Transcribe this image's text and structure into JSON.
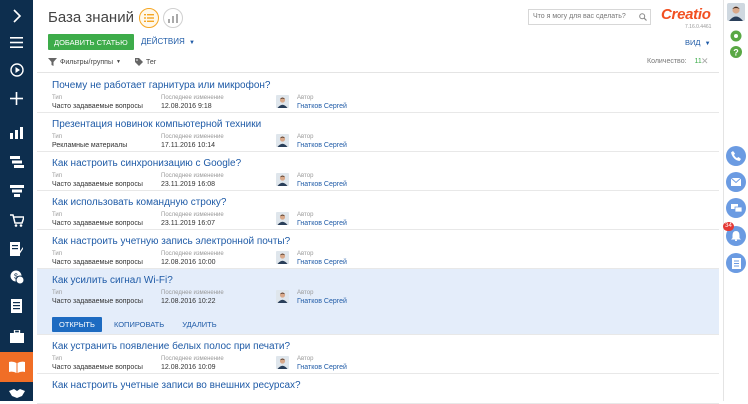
{
  "colors": {
    "nav_bg": "#0d2e4e",
    "nav_active": "#f06e26",
    "accent_green": "#3dac4a",
    "link_blue": "#1f5ba7",
    "selected_row": "#e4edfa",
    "comm_blue": "#6b9be2",
    "logo": "#f25022"
  },
  "leftnav": {
    "items": [
      {
        "icon": "chevron-right-icon"
      },
      {
        "icon": "menu-icon"
      },
      {
        "icon": "play-icon"
      },
      {
        "icon": "plus-icon"
      },
      {
        "icon": "chart-icon"
      },
      {
        "icon": "process-icon"
      },
      {
        "icon": "funnel-icon"
      },
      {
        "icon": "cart-icon"
      },
      {
        "icon": "document-edit-icon"
      },
      {
        "icon": "money-icon"
      },
      {
        "icon": "document-icon"
      },
      {
        "icon": "briefcase-icon"
      },
      {
        "icon": "book-icon",
        "active": true
      },
      {
        "icon": "handshake-icon"
      }
    ]
  },
  "header": {
    "title": "База знаний",
    "search_placeholder": "Что я могу для вас сделать?",
    "logo_text": "Creatio",
    "version": "7.16.0.4461"
  },
  "toolbar": {
    "add_label": "ДОБАВИТЬ СТАТЬЮ",
    "actions_label": "ДЕЙСТВИЯ",
    "view_label": "ВИД"
  },
  "filters": {
    "filters_label": "Фильтры/группы",
    "tag_label": "Тег",
    "count_label": "Количество:",
    "count_value": "11"
  },
  "columns": {
    "type": "Тип",
    "modified": "Последнее изменение",
    "author": "Автор"
  },
  "rows": [
    {
      "title": "Почему не работает гарнитура или микрофон?",
      "type": "Часто задаваемые вопросы",
      "modified": "12.08.2016 9:18",
      "author": "Гнатков Сергей"
    },
    {
      "title": "Презентация новинок компьютерной техники",
      "type": "Рекламные материалы",
      "modified": "17.11.2016 10:14",
      "author": "Гнатков Сергей"
    },
    {
      "title": "Как настроить синхронизацию с Google?",
      "type": "Часто задаваемые вопросы",
      "modified": "23.11.2019 16:08",
      "author": "Гнатков Сергей"
    },
    {
      "title": "Как использовать командную строку?",
      "type": "Часто задаваемые вопросы",
      "modified": "23.11.2019 16:07",
      "author": "Гнатков Сергей"
    },
    {
      "title": "Как настроить учетную запись электронной почты?",
      "type": "Часто задаваемые вопросы",
      "modified": "12.08.2016 10:00",
      "author": "Гнатков Сергей"
    },
    {
      "title": "Как усилить сигнал Wi-Fi?",
      "type": "Часто задаваемые вопросы",
      "modified": "12.08.2016 10:22",
      "author": "Гнатков Сергей",
      "selected": true
    },
    {
      "title": "Как устранить появление белых полос при печати?",
      "type": "Часто задаваемые вопросы",
      "modified": "12.08.2016 10:09",
      "author": "Гнатков Сергей"
    },
    {
      "title": "Как настроить учетные записи во внешних ресурсах?",
      "type": "",
      "modified": "",
      "author": ""
    }
  ],
  "row_actions": {
    "open": "ОТКРЫТЬ",
    "copy": "КОПИРОВАТЬ",
    "delete": "УДАЛИТЬ"
  },
  "rightpanel": {
    "notifications_count": "34"
  }
}
